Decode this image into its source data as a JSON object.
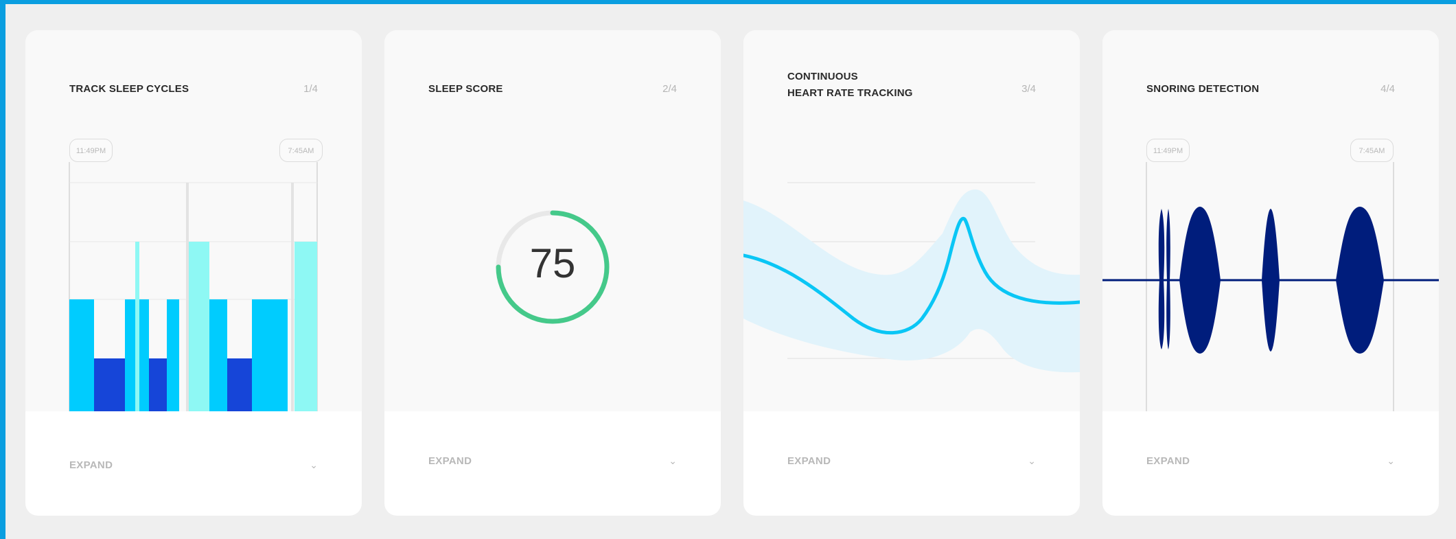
{
  "cards": [
    {
      "title_lines": [
        "TRACK SLEEP CYCLES"
      ],
      "counter": "1/4",
      "start_time": "11:49PM",
      "end_time": "7:45AM",
      "expand": "EXPAND"
    },
    {
      "title_lines": [
        "SLEEP SCORE"
      ],
      "counter": "2/4",
      "score": "75",
      "score_fraction": 0.75,
      "expand": "EXPAND"
    },
    {
      "title_lines": [
        "CONTINUOUS",
        "HEART RATE TRACKING"
      ],
      "counter": "3/4",
      "expand": "EXPAND"
    },
    {
      "title_lines": [
        "SNORING DETECTION"
      ],
      "counter": "4/4",
      "start_time": "11:49PM",
      "end_time": "7:45AM",
      "expand": "EXPAND"
    }
  ],
  "icons": {
    "expand_chevron": "chevron-down-icon"
  },
  "colors": {
    "background": "#efefef",
    "frame_border": "#0a9ee0",
    "stage_awake": "#8ef8f4",
    "stage_light": "#00ccfe",
    "stage_deep": "#1645d8",
    "score_ring": "#45c98a",
    "heart_line": "#0ac6f5",
    "heart_band": "#e1f3fb",
    "snore": "#001d7c"
  }
}
